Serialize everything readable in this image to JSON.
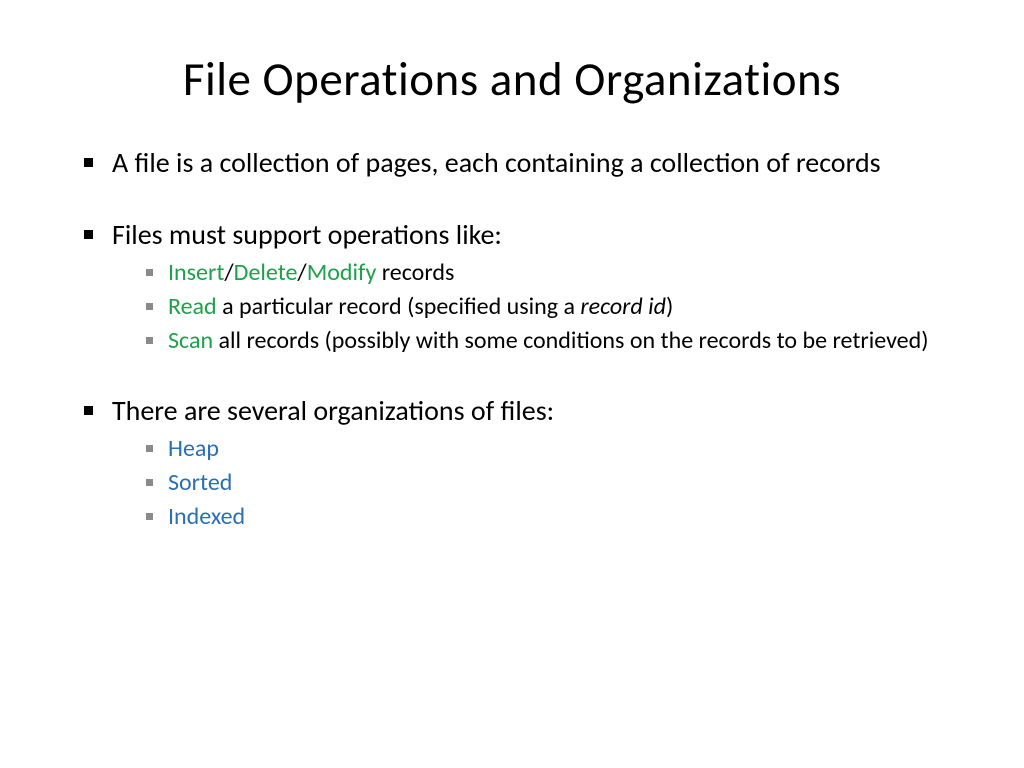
{
  "title": "File Operations and Organizations",
  "bullets": {
    "b1": "A file is a collection of pages, each containing a collection of records",
    "b2": "Files must support operations like:",
    "b3": "There are several organizations of files:"
  },
  "ops": {
    "insert": "Insert",
    "delete": "Delete",
    "modify": "Modify",
    "slash1": "/",
    "slash2": "/",
    "records_suffix": " records",
    "read": "Read",
    "read_suffix_a": " a particular record (specified using a ",
    "record_id": "record id",
    "read_suffix_b": ")",
    "scan": "Scan",
    "scan_suffix": " all records (possibly with some conditions on the records to be retrieved)"
  },
  "orgs": {
    "heap": "Heap",
    "sorted": "Sorted",
    "indexed": "Indexed"
  }
}
